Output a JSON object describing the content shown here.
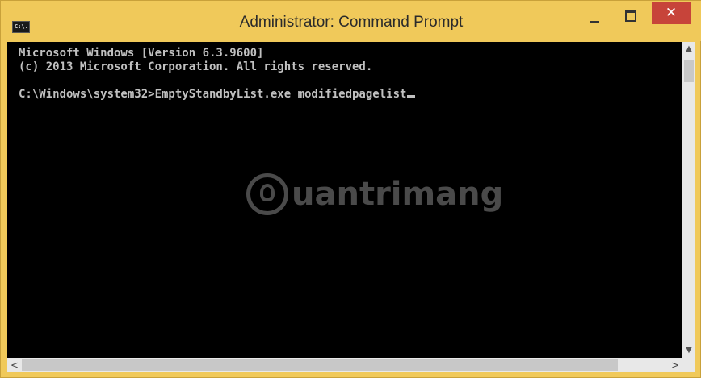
{
  "window": {
    "title": "Administrator: Command Prompt",
    "icon_label": "C:\\.",
    "controls": {
      "minimize": "minimize-icon",
      "maximize": "maximize-icon",
      "close_label": "✕"
    }
  },
  "console": {
    "lines": [
      "Microsoft Windows [Version 6.3.9600]",
      "(c) 2013 Microsoft Corporation. All rights reserved.",
      "",
      "C:\\Windows\\system32>EmptyStandbyList.exe modifiedpagelist"
    ]
  },
  "watermark": {
    "text": "uantrimang"
  },
  "scrollbars": {
    "up": "▲",
    "down": "▼",
    "left": "<",
    "right": ">"
  },
  "colors": {
    "frame": "#f0c95a",
    "close": "#c7443a",
    "console_bg": "#000000",
    "console_fg": "#c0c0c0"
  }
}
